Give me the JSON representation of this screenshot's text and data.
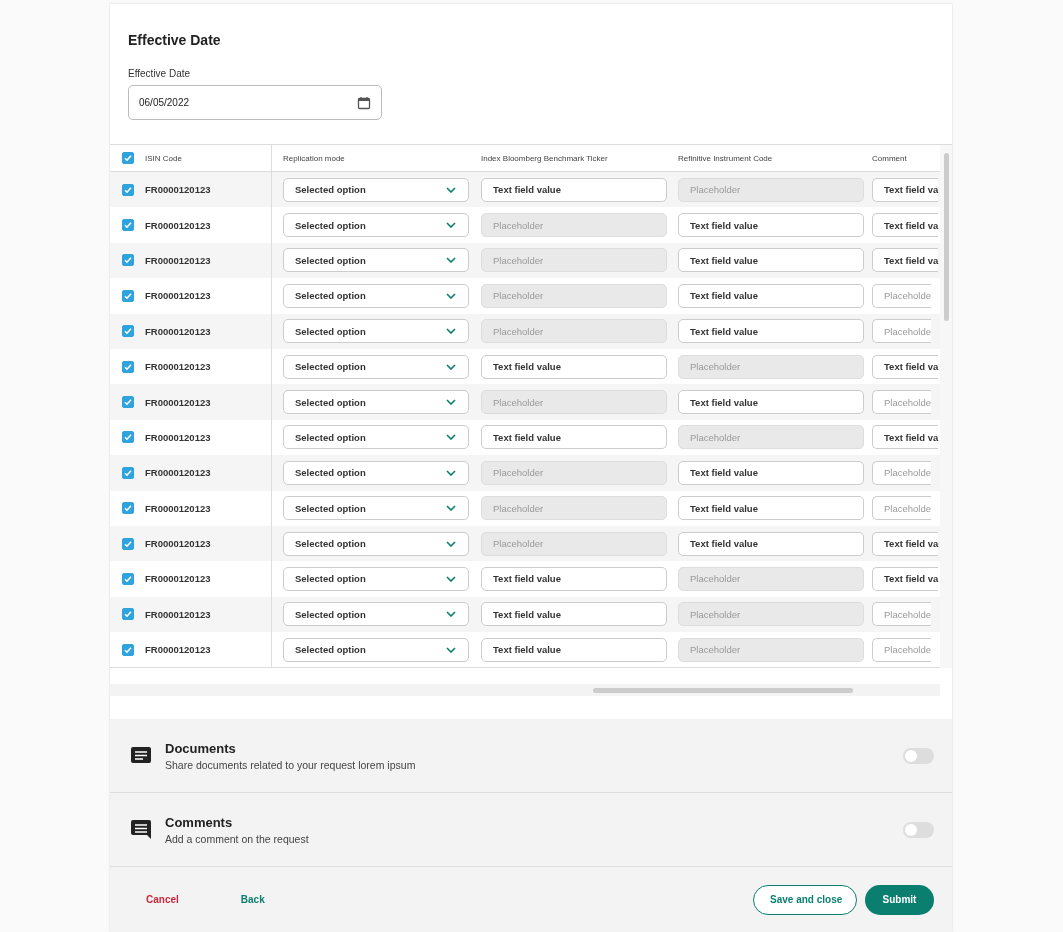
{
  "section": {
    "title": "Effective Date",
    "date_field": {
      "label": "Effective Date",
      "value": "06/05/2022"
    }
  },
  "table": {
    "select_all": {
      "checked": true
    },
    "columns": [
      "ISIN Code",
      "Replication mode",
      "Index Bloomberg Benchmark Ticker",
      "Refinitive Instrument Code",
      "Comment"
    ],
    "rows": [
      {
        "checked": true,
        "isin": "FR0000120123",
        "replication": "Selected option",
        "ticker": {
          "value": "Text field value",
          "disabled": false
        },
        "refinitive": {
          "placeholder": "Placeholder",
          "disabled": true
        },
        "comment": {
          "value": "Text field va",
          "disabled": false
        }
      },
      {
        "checked": true,
        "isin": "FR0000120123",
        "replication": "Selected option",
        "ticker": {
          "placeholder": "Placeholder",
          "disabled": true
        },
        "refinitive": {
          "value": "Text field value",
          "disabled": false
        },
        "comment": {
          "value": "Text field va",
          "disabled": false
        }
      },
      {
        "checked": true,
        "isin": "FR0000120123",
        "replication": "Selected option",
        "ticker": {
          "placeholder": "Placeholder",
          "disabled": true
        },
        "refinitive": {
          "value": "Text field value",
          "disabled": false
        },
        "comment": {
          "value": "Text field va",
          "disabled": false
        }
      },
      {
        "checked": true,
        "isin": "FR0000120123",
        "replication": "Selected option",
        "ticker": {
          "placeholder": "Placeholder",
          "disabled": true
        },
        "refinitive": {
          "value": "Text field value",
          "disabled": false
        },
        "comment": {
          "placeholder": "Placeholde",
          "disabled": false
        }
      },
      {
        "checked": true,
        "isin": "FR0000120123",
        "replication": "Selected option",
        "ticker": {
          "placeholder": "Placeholder",
          "disabled": true
        },
        "refinitive": {
          "value": "Text field value",
          "disabled": false
        },
        "comment": {
          "placeholder": "Placeholde",
          "disabled": false
        }
      },
      {
        "checked": true,
        "isin": "FR0000120123",
        "replication": "Selected option",
        "ticker": {
          "value": "Text field value",
          "disabled": false
        },
        "refinitive": {
          "placeholder": "Placeholder",
          "disabled": true
        },
        "comment": {
          "value": "Text field va",
          "disabled": false
        }
      },
      {
        "checked": true,
        "isin": "FR0000120123",
        "replication": "Selected option",
        "ticker": {
          "placeholder": "Placeholder",
          "disabled": true
        },
        "refinitive": {
          "value": "Text field value",
          "disabled": false
        },
        "comment": {
          "placeholder": "Placeholde",
          "disabled": false
        }
      },
      {
        "checked": true,
        "isin": "FR0000120123",
        "replication": "Selected option",
        "ticker": {
          "value": "Text field value",
          "disabled": false
        },
        "refinitive": {
          "placeholder": "Placeholder",
          "disabled": true
        },
        "comment": {
          "value": "Text field va",
          "disabled": false
        }
      },
      {
        "checked": true,
        "isin": "FR0000120123",
        "replication": "Selected option",
        "ticker": {
          "placeholder": "Placeholder",
          "disabled": true
        },
        "refinitive": {
          "value": "Text field value",
          "disabled": false
        },
        "comment": {
          "placeholder": "Placeholde",
          "disabled": false
        }
      },
      {
        "checked": true,
        "isin": "FR0000120123",
        "replication": "Selected option",
        "ticker": {
          "placeholder": "Placeholder",
          "disabled": true
        },
        "refinitive": {
          "value": "Text field value",
          "disabled": false
        },
        "comment": {
          "placeholder": "Placeholde",
          "disabled": false
        }
      },
      {
        "checked": true,
        "isin": "FR0000120123",
        "replication": "Selected option",
        "ticker": {
          "placeholder": "Placeholder",
          "disabled": true
        },
        "refinitive": {
          "value": "Text field value",
          "disabled": false
        },
        "comment": {
          "value": "Text field va",
          "disabled": false
        }
      },
      {
        "checked": true,
        "isin": "FR0000120123",
        "replication": "Selected option",
        "ticker": {
          "value": "Text field value",
          "disabled": false
        },
        "refinitive": {
          "placeholder": "Placeholder",
          "disabled": true
        },
        "comment": {
          "value": "Text field va",
          "disabled": false
        }
      },
      {
        "checked": true,
        "isin": "FR0000120123",
        "replication": "Selected option",
        "ticker": {
          "value": "Text field value",
          "disabled": false
        },
        "refinitive": {
          "placeholder": "Placeholder",
          "disabled": true
        },
        "comment": {
          "placeholder": "Placeholde",
          "disabled": false
        }
      },
      {
        "checked": true,
        "isin": "FR0000120123",
        "replication": "Selected option",
        "ticker": {
          "value": "Text field value",
          "disabled": false
        },
        "refinitive": {
          "placeholder": "Placeholder",
          "disabled": true
        },
        "comment": {
          "placeholder": "Placeholde",
          "disabled": false
        }
      }
    ]
  },
  "panels": [
    {
      "kind": "documents",
      "title": "Documents",
      "description": "Share documents related to your request lorem ipsum",
      "on": false
    },
    {
      "kind": "comments",
      "title": "Comments",
      "description": "Add a comment on the request",
      "on": false
    }
  ],
  "footer": {
    "cancel": "Cancel",
    "back": "Back",
    "save": "Save and close",
    "submit": "Submit"
  }
}
